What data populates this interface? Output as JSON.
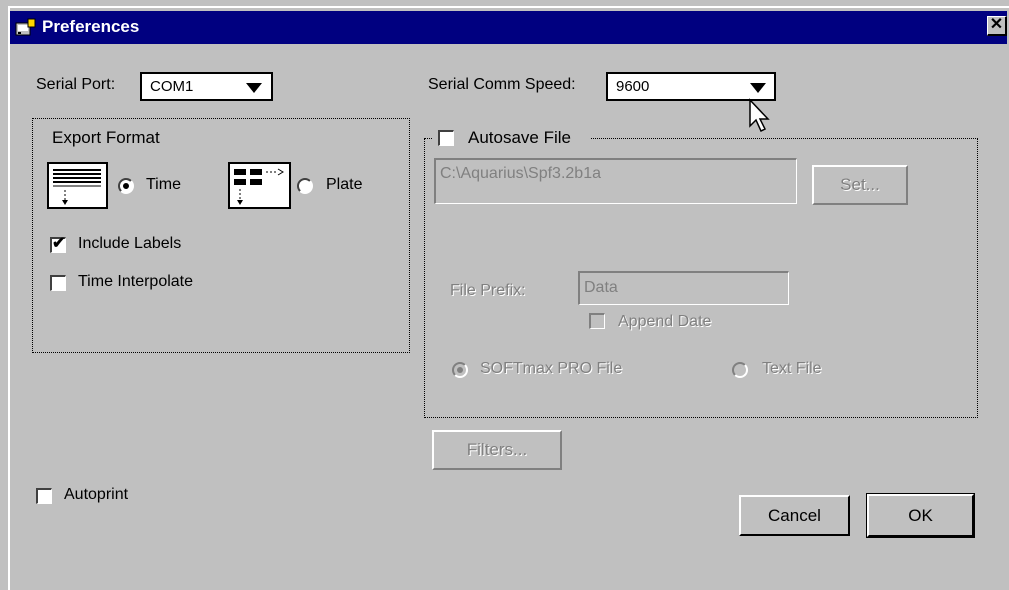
{
  "window": {
    "title": "Preferences",
    "close_glyph": "✕"
  },
  "serial_port": {
    "label": "Serial Port:",
    "value": "COM1"
  },
  "serial_speed": {
    "label": "Serial Comm Speed:",
    "value": "9600"
  },
  "export_format": {
    "title": "Export Format",
    "option_time": "Time",
    "option_plate": "Plate",
    "selected": "Time",
    "include_labels": {
      "label": "Include Labels",
      "checked": true
    },
    "time_interpolate": {
      "label": "Time Interpolate",
      "checked": false
    }
  },
  "autosave": {
    "label": "Autosave File",
    "checked": false,
    "path_value": "C:\\Aquarius\\Spf3.2b1a",
    "set_button": "Set...",
    "file_prefix_label": "File Prefix:",
    "file_prefix_value": "Data",
    "append_date_label": "Append Date",
    "format_softmax": "SOFTmax PRO File",
    "format_text": "Text File"
  },
  "filters_button": "Filters...",
  "autoprint": {
    "label": "Autoprint",
    "checked": false
  },
  "buttons": {
    "cancel": "Cancel",
    "ok": "OK"
  },
  "icons": {
    "window_icon": "app-preferences-icon",
    "check": "✔"
  }
}
